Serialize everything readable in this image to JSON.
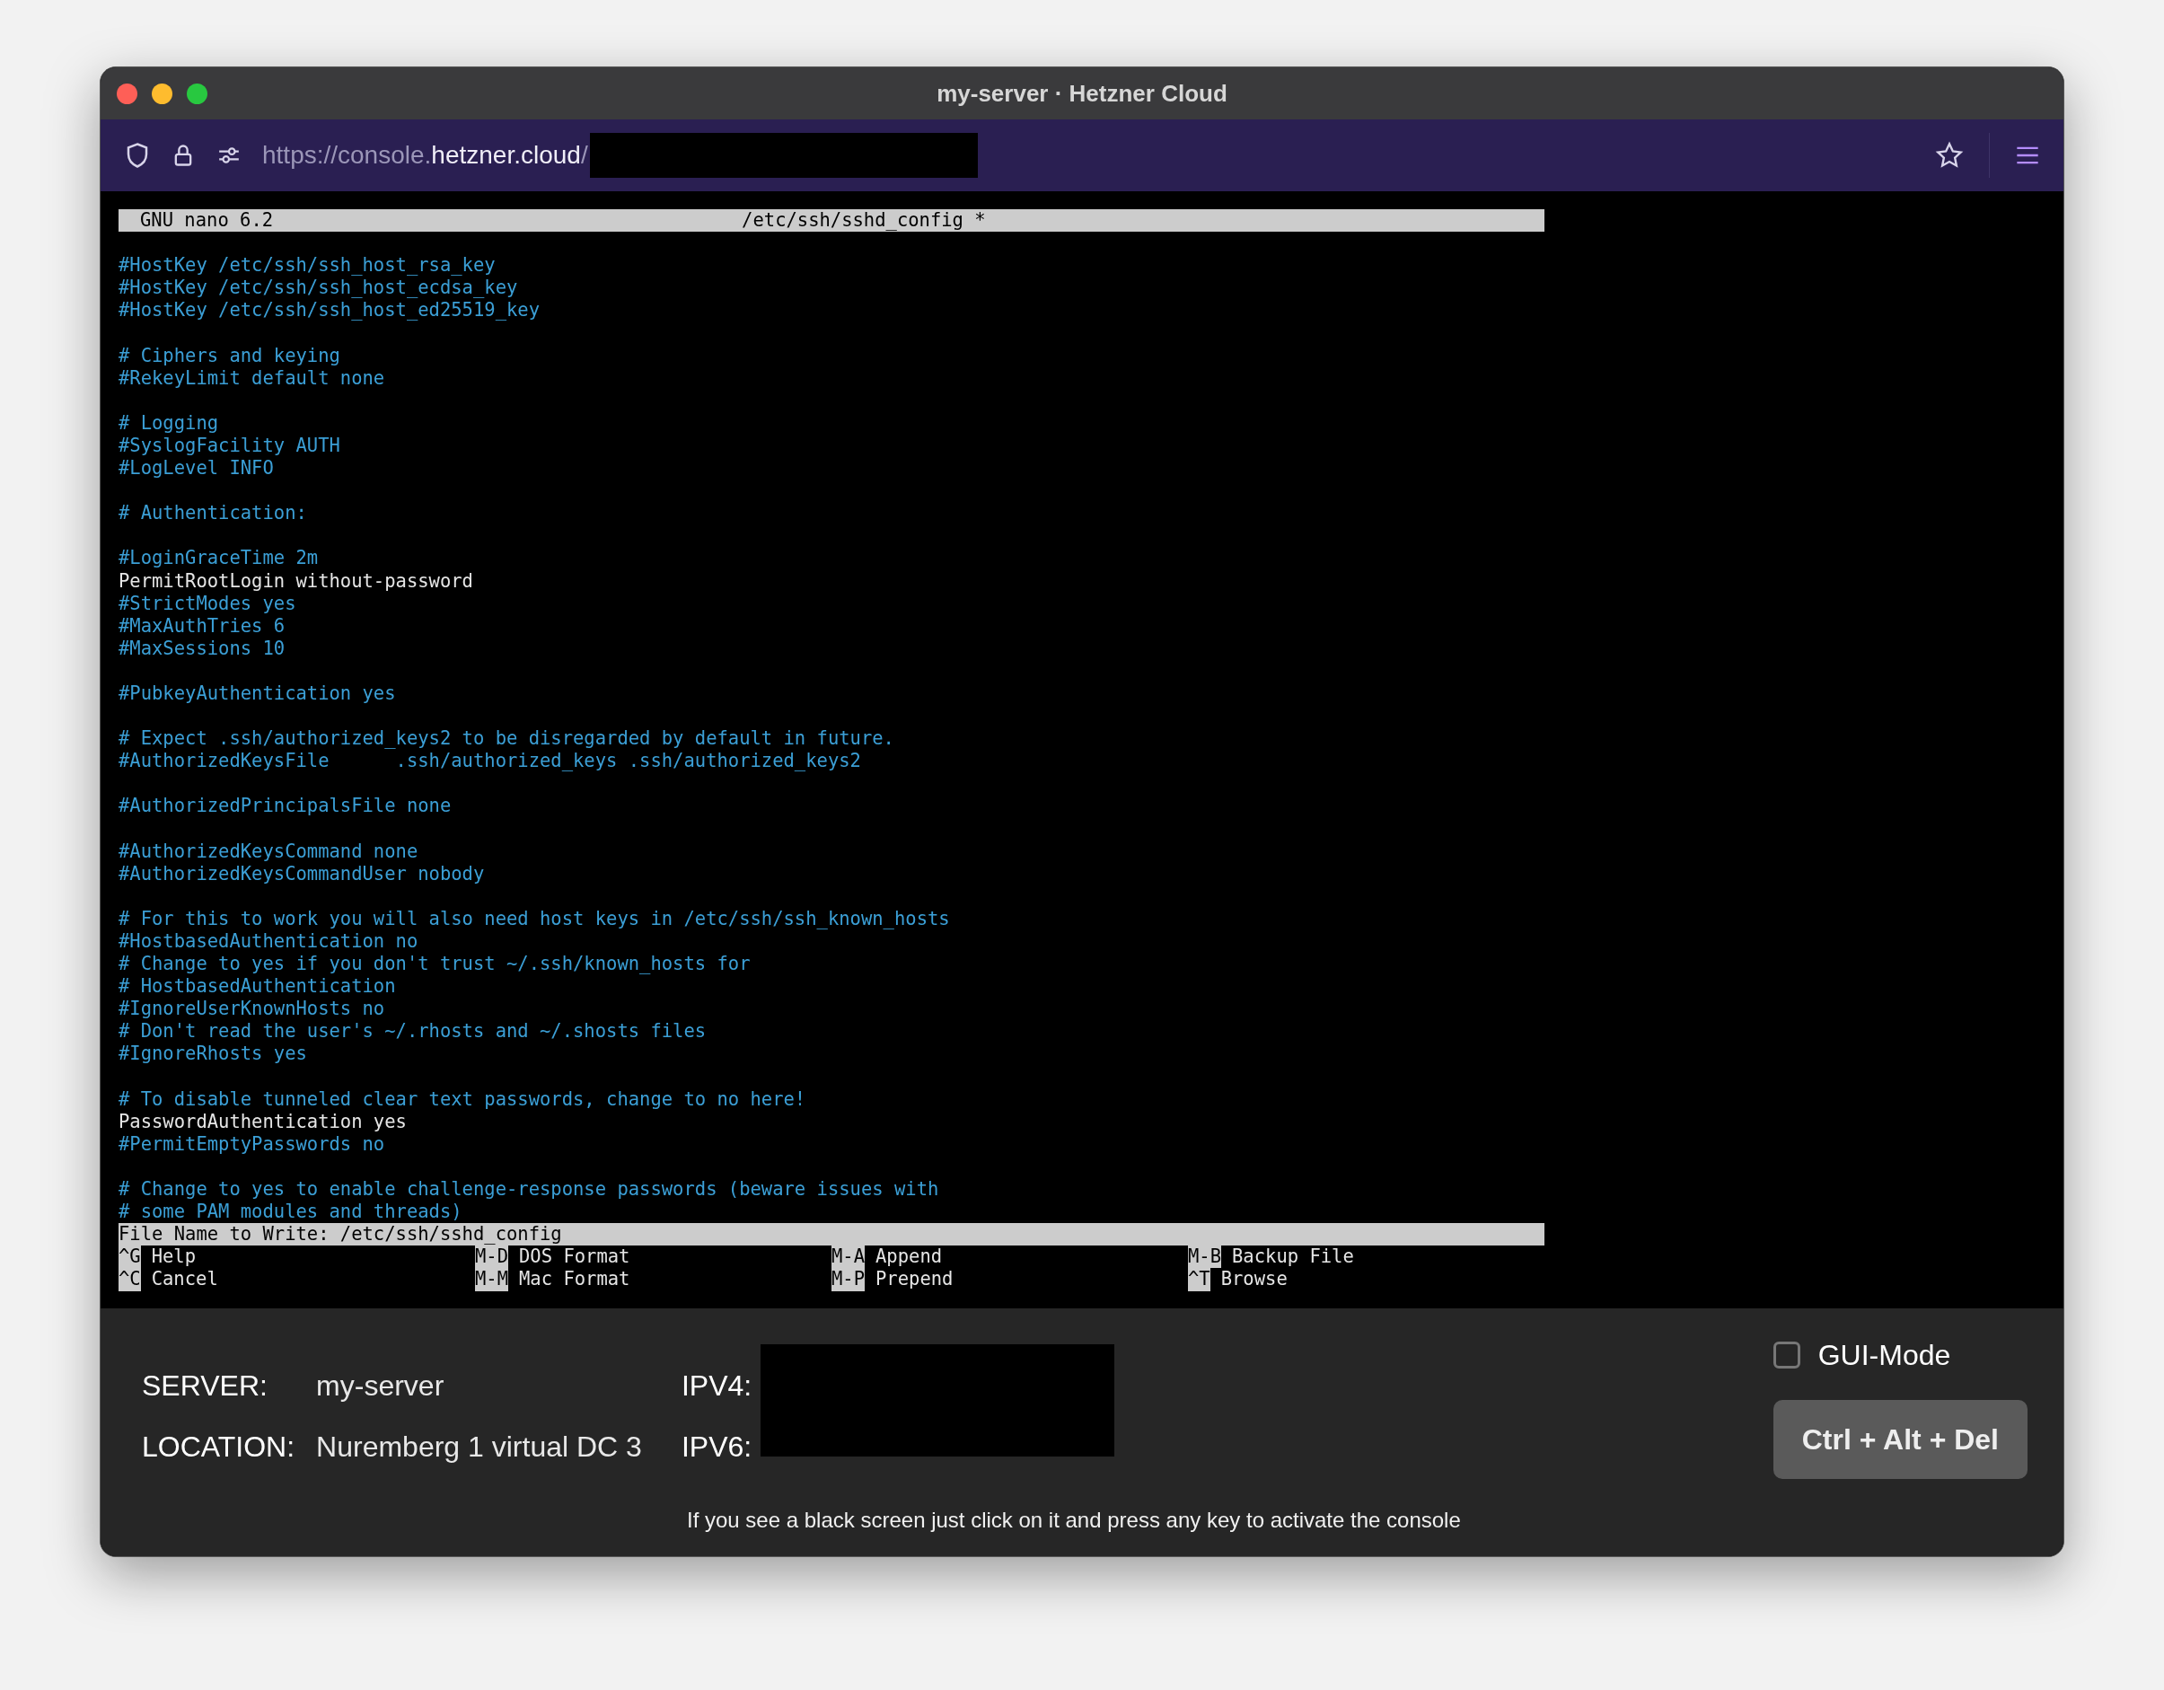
{
  "window": {
    "title": "my-server · Hetzner Cloud"
  },
  "address_bar": {
    "url_prefix": "https://console.",
    "url_domain": "hetzner.cloud",
    "url_suffix": "/"
  },
  "editor": {
    "title_bar": {
      "program": "GNU nano 6.2",
      "file": "/etc/ssh/sshd_config *"
    },
    "lines": [
      {
        "kind": "blank"
      },
      {
        "kind": "comment",
        "text": "#HostKey /etc/ssh/ssh_host_rsa_key"
      },
      {
        "kind": "comment",
        "text": "#HostKey /etc/ssh/ssh_host_ecdsa_key"
      },
      {
        "kind": "comment",
        "text": "#HostKey /etc/ssh/ssh_host_ed25519_key"
      },
      {
        "kind": "blank"
      },
      {
        "kind": "comment",
        "text": "# Ciphers and keying"
      },
      {
        "kind": "comment",
        "text": "#RekeyLimit default none"
      },
      {
        "kind": "blank"
      },
      {
        "kind": "comment",
        "text": "# Logging"
      },
      {
        "kind": "comment",
        "text": "#SyslogFacility AUTH"
      },
      {
        "kind": "comment",
        "text": "#LogLevel INFO"
      },
      {
        "kind": "blank"
      },
      {
        "kind": "comment",
        "text": "# Authentication:"
      },
      {
        "kind": "blank"
      },
      {
        "kind": "comment",
        "text": "#LoginGraceTime 2m"
      },
      {
        "kind": "setting",
        "text": "PermitRootLogin without-password"
      },
      {
        "kind": "comment",
        "text": "#StrictModes yes"
      },
      {
        "kind": "comment",
        "text": "#MaxAuthTries 6"
      },
      {
        "kind": "comment",
        "text": "#MaxSessions 10"
      },
      {
        "kind": "blank"
      },
      {
        "kind": "comment",
        "text": "#PubkeyAuthentication yes"
      },
      {
        "kind": "blank"
      },
      {
        "kind": "comment",
        "text": "# Expect .ssh/authorized_keys2 to be disregarded by default in future."
      },
      {
        "kind": "comment",
        "text": "#AuthorizedKeysFile      .ssh/authorized_keys .ssh/authorized_keys2"
      },
      {
        "kind": "blank"
      },
      {
        "kind": "comment",
        "text": "#AuthorizedPrincipalsFile none"
      },
      {
        "kind": "blank"
      },
      {
        "kind": "comment",
        "text": "#AuthorizedKeysCommand none"
      },
      {
        "kind": "comment",
        "text": "#AuthorizedKeysCommandUser nobody"
      },
      {
        "kind": "blank"
      },
      {
        "kind": "comment",
        "text": "# For this to work you will also need host keys in /etc/ssh/ssh_known_hosts"
      },
      {
        "kind": "comment",
        "text": "#HostbasedAuthentication no"
      },
      {
        "kind": "comment",
        "text": "# Change to yes if you don't trust ~/.ssh/known_hosts for"
      },
      {
        "kind": "comment",
        "text": "# HostbasedAuthentication"
      },
      {
        "kind": "comment",
        "text": "#IgnoreUserKnownHosts no"
      },
      {
        "kind": "comment",
        "text": "# Don't read the user's ~/.rhosts and ~/.shosts files"
      },
      {
        "kind": "comment",
        "text": "#IgnoreRhosts yes"
      },
      {
        "kind": "blank"
      },
      {
        "kind": "comment",
        "text": "# To disable tunneled clear text passwords, change to no here!"
      },
      {
        "kind": "setting",
        "text": "PasswordAuthentication yes"
      },
      {
        "kind": "comment",
        "text": "#PermitEmptyPasswords no"
      },
      {
        "kind": "blank"
      },
      {
        "kind": "comment",
        "text": "# Change to yes to enable challenge-response passwords (beware issues with"
      },
      {
        "kind": "comment",
        "text": "# some PAM modules and threads)"
      }
    ],
    "prompt": "File Name to Write: /etc/ssh/sshd_config",
    "shortcut_rows": [
      [
        {
          "key": "^G",
          "label": "Help"
        },
        {
          "key": "M-D",
          "label": "DOS Format"
        },
        {
          "key": "M-A",
          "label": "Append"
        },
        {
          "key": "M-B",
          "label": "Backup File"
        }
      ],
      [
        {
          "key": "^C",
          "label": "Cancel"
        },
        {
          "key": "M-M",
          "label": "Mac Format"
        },
        {
          "key": "M-P",
          "label": "Prepend"
        },
        {
          "key": "^T",
          "label": "Browse"
        }
      ]
    ]
  },
  "info_panel": {
    "server_label": "SERVER:",
    "server": "my-server",
    "location_label": "LOCATION:",
    "location": "Nuremberg 1 virtual DC 3",
    "ipv4_label": "IPV4:",
    "ipv6_label": "IPV6:",
    "gui_mode": {
      "label": "GUI-Mode",
      "checked": false
    },
    "button": "Ctrl + Alt + Del",
    "hint": "If you see a black screen just click on it and press any key to activate the console"
  }
}
